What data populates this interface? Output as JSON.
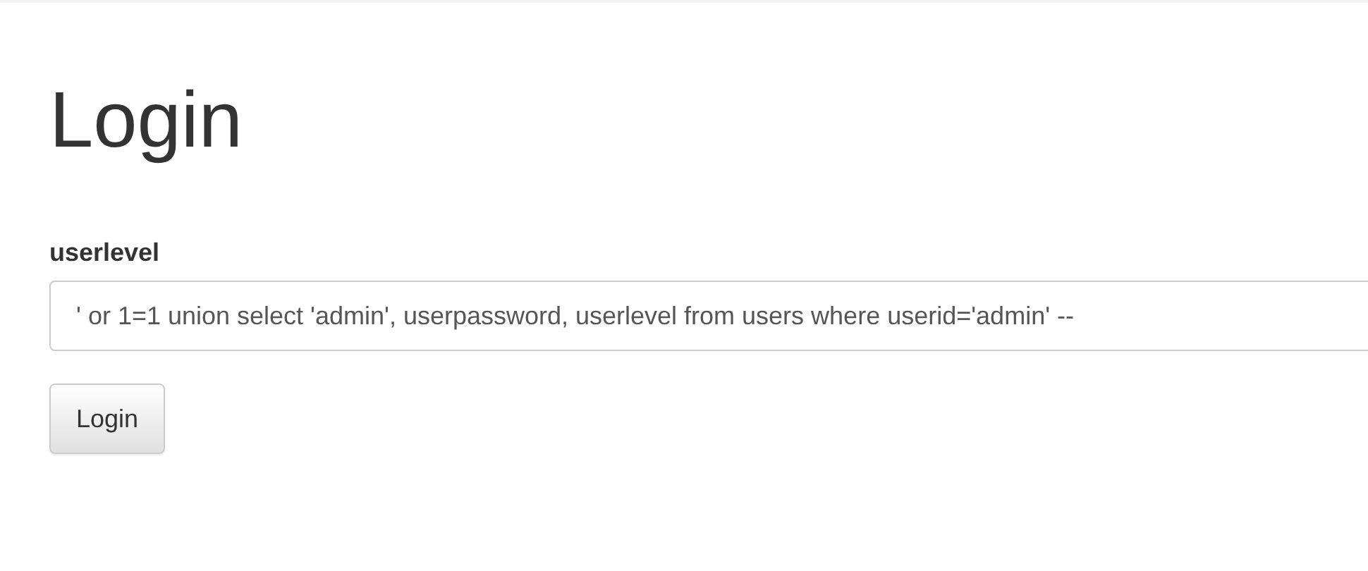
{
  "title": "Login",
  "form": {
    "label": "userlevel",
    "value": "' or 1=1 union select 'admin', userpassword, userlevel from users where userid='admin' --"
  },
  "buttons": [
    "Login"
  ]
}
